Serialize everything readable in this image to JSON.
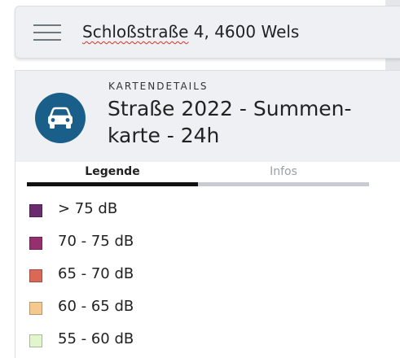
{
  "search": {
    "street": "Schloßstraße",
    "rest": " 4, 4600 Wels"
  },
  "panel": {
    "kicker": "KARTENDETAILS",
    "title": "Straße 2022 - Summen-karte - 24h",
    "icon": "car-icon",
    "icon_bg": "#1a5e8a"
  },
  "tabs": [
    {
      "label": "Legende",
      "active": true
    },
    {
      "label": "Infos",
      "active": false
    }
  ],
  "legend": [
    {
      "label": "> 75 dB",
      "color": "#6a2c6e"
    },
    {
      "label": "70 - 75 dB",
      "color": "#94306e"
    },
    {
      "label": "65 - 70 dB",
      "color": "#db6757"
    },
    {
      "label": "60 - 65 dB",
      "color": "#f5c890"
    },
    {
      "label": "55 - 60 dB",
      "color": "#e3f5cc"
    }
  ]
}
